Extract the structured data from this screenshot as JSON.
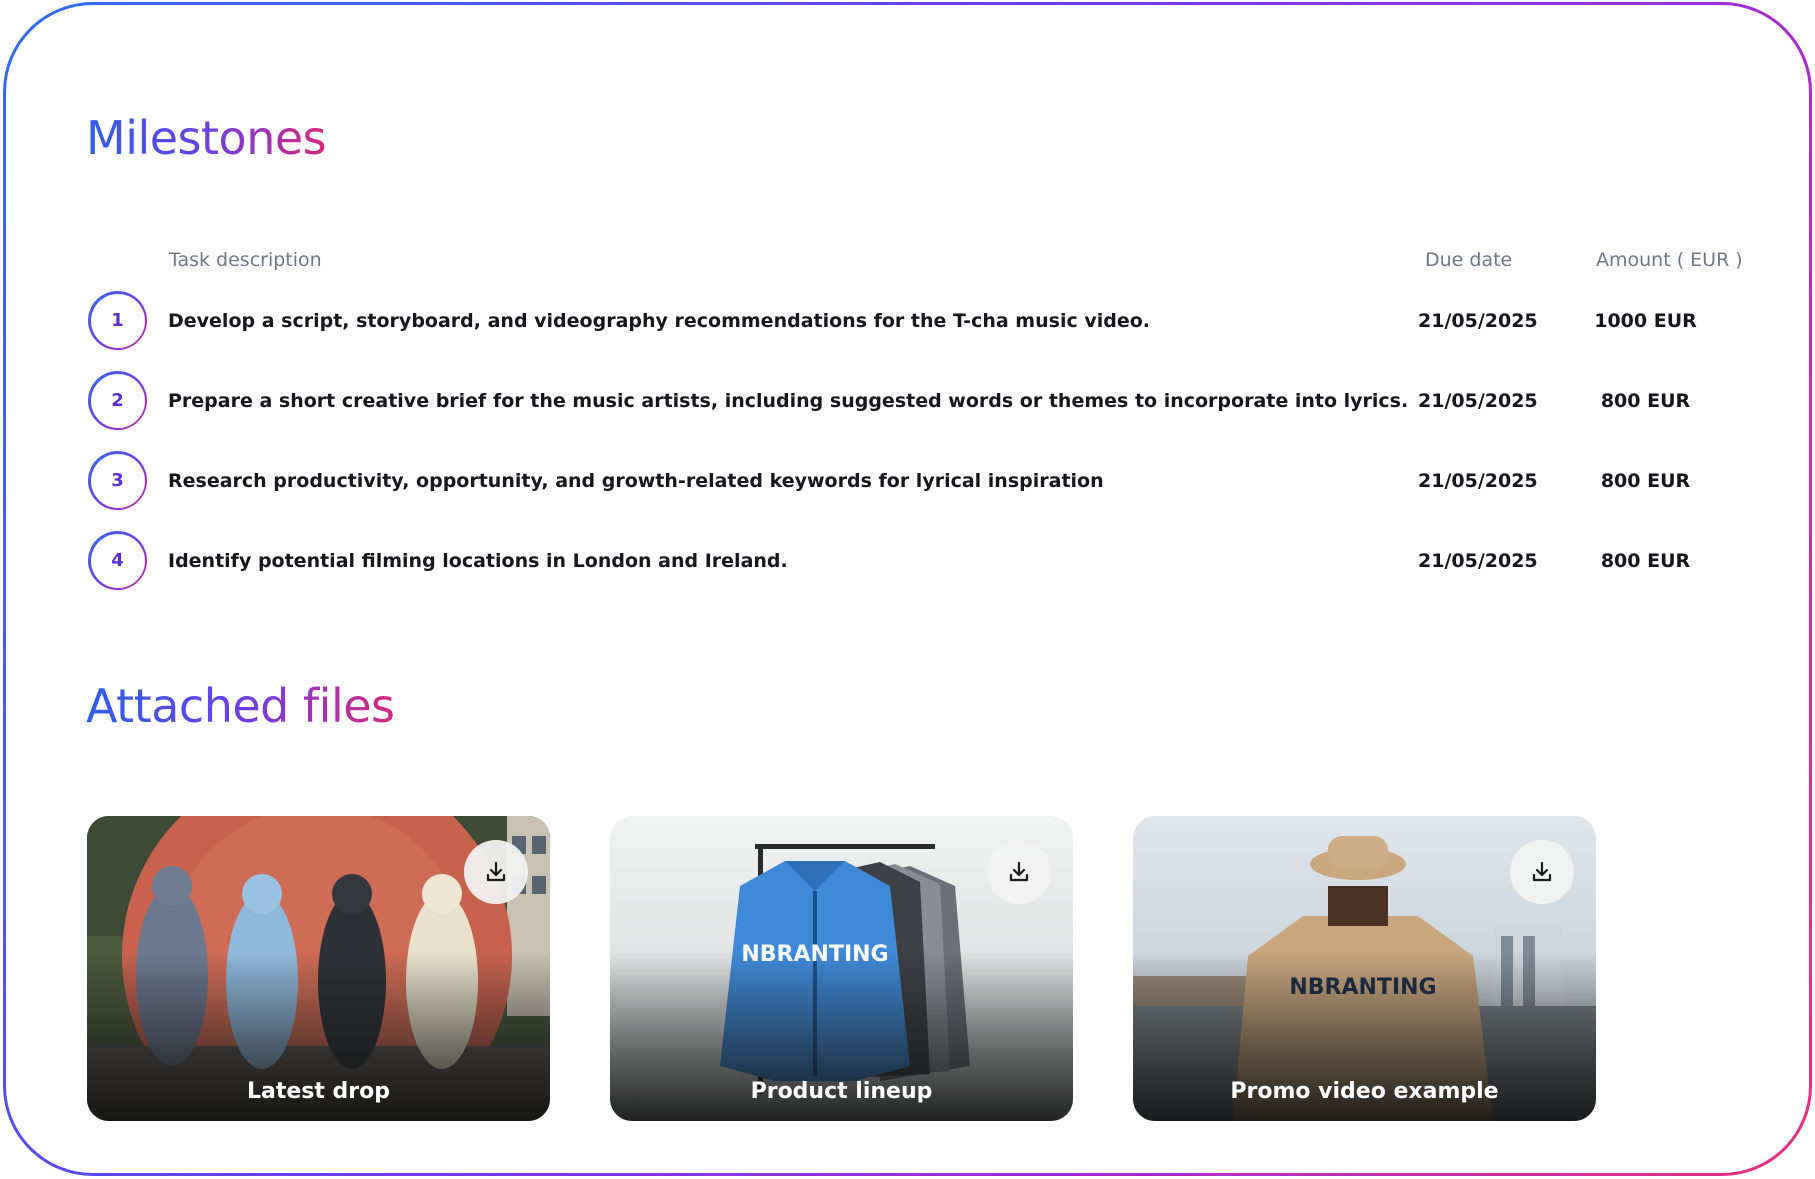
{
  "milestones": {
    "title": "Milestones",
    "headers": {
      "task": "Task description",
      "due": "Due date",
      "amount": "Amount ( EUR )"
    },
    "rows": [
      {
        "number": "1",
        "task": "Develop a script, storyboard, and videography recommendations for the T-cha music video.",
        "due": "21/05/2025",
        "amount": "1000 EUR"
      },
      {
        "number": "2",
        "task": "Prepare a short creative brief for the music artists, including suggested words or themes to incorporate into lyrics.",
        "due": "21/05/2025",
        "amount": "800 EUR"
      },
      {
        "number": "3",
        "task": "Research productivity, opportunity, and growth-related keywords for lyrical inspiration",
        "due": "21/05/2025",
        "amount": "800 EUR"
      },
      {
        "number": "4",
        "task": "Identify potential filming locations in London and Ireland.",
        "due": "21/05/2025",
        "amount": "800 EUR"
      }
    ]
  },
  "attachments": {
    "title": "Attached files",
    "files": [
      {
        "label": "Latest drop",
        "icon": "download-icon"
      },
      {
        "label": "Product lineup",
        "icon": "download-icon"
      },
      {
        "label": "Promo video example",
        "icon": "download-icon"
      }
    ]
  },
  "colors": {
    "gradient_start": "#2f6df0",
    "gradient_mid": "#7a37e8",
    "gradient_end": "#e8317b",
    "text_primary": "#16161c",
    "text_muted": "#707784"
  }
}
